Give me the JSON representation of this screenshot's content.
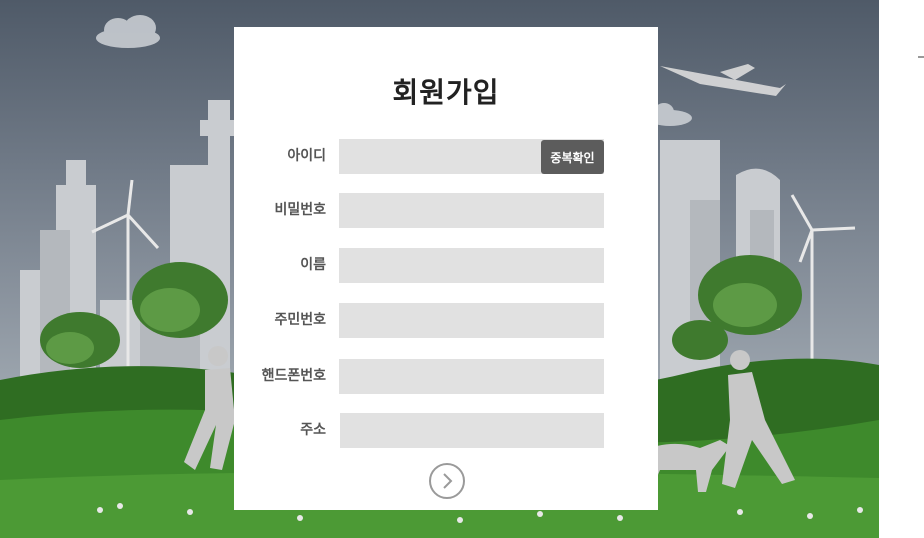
{
  "signup": {
    "title": "회원가입",
    "fields": [
      {
        "label": "아이디",
        "value": "",
        "placeholder": ""
      },
      {
        "label": "비밀번호",
        "value": "",
        "placeholder": ""
      },
      {
        "label": "이름",
        "value": "",
        "placeholder": ""
      },
      {
        "label": "주민번호",
        "value": "",
        "placeholder": ""
      },
      {
        "label": "핸드폰번호",
        "value": "",
        "placeholder": ""
      },
      {
        "label": "주소",
        "value": "",
        "placeholder": ""
      }
    ],
    "duplicate_check_label": "중복확인",
    "next_icon": "chevron-right-circle-icon"
  },
  "colors": {
    "field_bg": "#e1e1e1",
    "button_bg": "#5c5c5c",
    "card_bg": "#ffffff"
  }
}
